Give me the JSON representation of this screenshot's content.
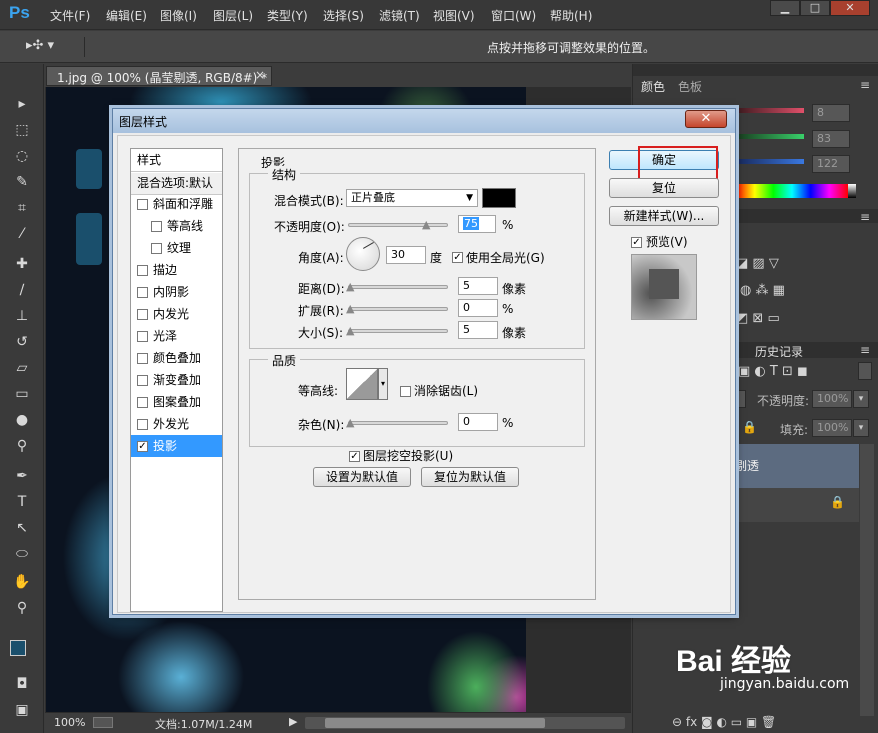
{
  "app": {
    "logo": "Ps"
  },
  "menu": [
    "文件(F)",
    "编辑(E)",
    "图像(I)",
    "图层(L)",
    "类型(Y)",
    "选择(S)",
    "滤镜(T)",
    "视图(V)",
    "窗口(W)",
    "帮助(H)"
  ],
  "window_controls": {
    "minimize": "▁",
    "maximize": "□",
    "close": "✕"
  },
  "options_bar": {
    "hint": "点按并拖移可调整效果的位置。"
  },
  "document": {
    "tab_title": "1.jpg @ 100% (晶莹剔透, RGB/8#) *",
    "tab_close": "×",
    "zoom": "100%",
    "doc_size": "文档:1.07M/1.24M"
  },
  "panels": {
    "tabs": [
      "颜色",
      "色板"
    ],
    "color_values": [
      "8",
      "83",
      "122"
    ],
    "history_tab": "历史记录",
    "opacity_label": "不透明度:",
    "opacity_value": "100%",
    "fill_label": "填充:",
    "fill_value": "100%",
    "layer_name": "剔透"
  },
  "watermark": {
    "logo": "Bai 经验",
    "url": "jingyan.baidu.com"
  },
  "dialog": {
    "title": "图层样式",
    "close": "✕",
    "styles_header": "样式",
    "blend_options": "混合选项:默认",
    "style_items": [
      {
        "label": "斜面和浮雕",
        "checked": false,
        "indent": false
      },
      {
        "label": "等高线",
        "checked": false,
        "indent": true
      },
      {
        "label": "纹理",
        "checked": false,
        "indent": true
      },
      {
        "label": "描边",
        "checked": false,
        "indent": false
      },
      {
        "label": "内阴影",
        "checked": false,
        "indent": false
      },
      {
        "label": "内发光",
        "checked": false,
        "indent": false
      },
      {
        "label": "光泽",
        "checked": false,
        "indent": false
      },
      {
        "label": "颜色叠加",
        "checked": false,
        "indent": false
      },
      {
        "label": "渐变叠加",
        "checked": false,
        "indent": false
      },
      {
        "label": "图案叠加",
        "checked": false,
        "indent": false
      },
      {
        "label": "外发光",
        "checked": false,
        "indent": false
      },
      {
        "label": "投影",
        "checked": true,
        "indent": false,
        "active": true
      }
    ],
    "section_title": "投影",
    "structure": {
      "title": "结构",
      "blend_mode_label": "混合模式(B):",
      "blend_mode_value": "正片叠底",
      "blend_color": "#000000",
      "opacity_label": "不透明度(O):",
      "opacity_value": "75",
      "opacity_unit": "%",
      "angle_label": "角度(A):",
      "angle_value": "30",
      "angle_unit": "度",
      "global_light_label": "使用全局光(G)",
      "global_light_checked": true,
      "distance_label": "距离(D):",
      "distance_value": "5",
      "distance_unit": "像素",
      "spread_label": "扩展(R):",
      "spread_value": "0",
      "spread_unit": "%",
      "size_label": "大小(S):",
      "size_value": "5",
      "size_unit": "像素"
    },
    "quality": {
      "title": "品质",
      "contour_label": "等高线:",
      "antialias_label": "消除锯齿(L)",
      "antialias_checked": false,
      "noise_label": "杂色(N):",
      "noise_value": "0",
      "noise_unit": "%"
    },
    "knockout_label": "图层挖空投影(U)",
    "knockout_checked": true,
    "make_default": "设置为默认值",
    "reset_default": "复位为默认值",
    "ok": "确定",
    "reset": "复位",
    "new_style": "新建样式(W)...",
    "preview_label": "预览(V)",
    "preview_checked": true
  }
}
